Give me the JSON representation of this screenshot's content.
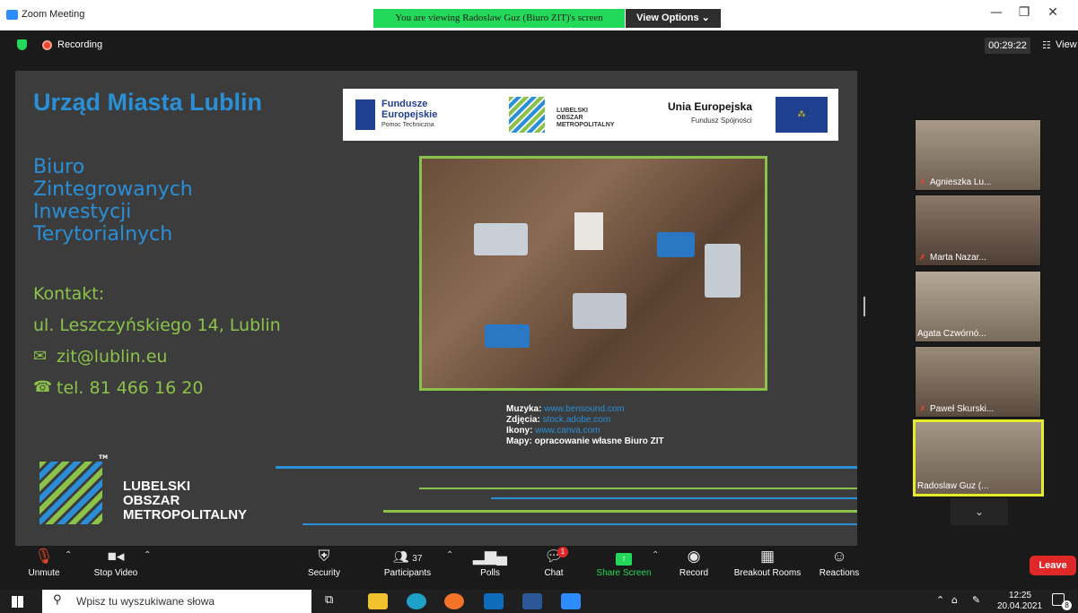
{
  "window": {
    "title": "Zoom Meeting"
  },
  "banner": {
    "text": "You are viewing Radoslaw Guz (Biuro ZIT)'s screen",
    "view_options": "View Options ⌄"
  },
  "header": {
    "recording": "Recording",
    "timer": "00:29:22",
    "view": "View"
  },
  "slide": {
    "title": "Urząd Miasta Lublin",
    "subtitle_lines": [
      "Biuro",
      "Zintegrowanych",
      "Inwestycji",
      "Terytorialnych"
    ],
    "contact_label": "Kontakt:",
    "address": "ul. Leszczyńskiego 14, Lublin",
    "email": "zit@lublin.eu",
    "phone": "tel. 81 466 16 20",
    "logos": {
      "fe_line1": "Fundusze",
      "fe_line2": "Europejskie",
      "fe_line3": "Pomoc Techniczna",
      "lom_line1": "LUBELSKI",
      "lom_line2": "OBSZAR",
      "lom_line3": "METROPOLITALNY",
      "ue_line1": "Unia Europejska",
      "ue_line2": "Fundusz Spójności"
    },
    "credits": {
      "music_label": "Muzyka:",
      "music_value": "www.bensound.com",
      "photos_label": "Zdjęcia:",
      "photos_value": "stock.adobe.com",
      "icons_label": "Ikony:",
      "icons_value": "www.canva.com",
      "maps_label": "Mapy: opracowanie własne Biuro ZIT"
    },
    "bottom_logo": {
      "line1": "LUBELSKI",
      "line2": "OBSZAR",
      "line3": "METROPOLITALNY",
      "tm": "TM"
    }
  },
  "participants": [
    {
      "name": "Agnieszka Lu...",
      "muted": true
    },
    {
      "name": "Marta Nazar...",
      "muted": true
    },
    {
      "name": "Agata Czwórnó...",
      "muted": false
    },
    {
      "name": "Paweł Skurski...",
      "muted": true
    },
    {
      "name": "Radoslaw Guz (...",
      "muted": false,
      "active": true
    }
  ],
  "toolbar": {
    "unmute": "Unmute",
    "stop_video": "Stop Video",
    "security": "Security",
    "participants": "Participants",
    "participants_count": "37",
    "polls": "Polls",
    "chat": "Chat",
    "chat_badge": "1",
    "share_screen": "Share Screen",
    "record": "Record",
    "breakout_rooms": "Breakout Rooms",
    "reactions": "Reactions",
    "leave": "Leave"
  },
  "taskbar": {
    "search_placeholder": "Wpisz tu wyszukiwane słowa",
    "time": "12:25",
    "date": "20.04.2021",
    "notification_count": "8"
  },
  "colors": {
    "accent_green": "#23d959",
    "slide_blue": "#2a8fd6",
    "slide_green": "#8bc34a",
    "leave_red": "#e02828"
  }
}
